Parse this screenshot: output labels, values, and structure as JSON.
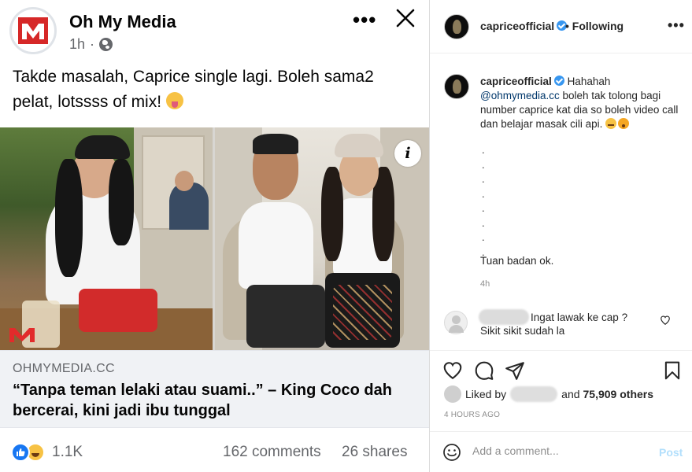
{
  "facebook": {
    "page_name": "Oh My Media",
    "post_time": "1h",
    "separator": "·",
    "post_text": "Takde masalah, Caprice single lagi. Boleh sama2 pelat, lotssss of mix!",
    "link": {
      "domain": "OHMYMEDIA.CC",
      "headline": "“Tanpa teman lelaki atau suami..” – King Coco dah bercerai, kini jadi ibu tunggal"
    },
    "reactions_count": "1.1K",
    "comments": "162 comments",
    "shares": "26 shares",
    "info_glyph": "i",
    "icons": {
      "more": "more-horizontal-icon",
      "close": "close-icon",
      "privacy": "globe-icon",
      "like": "like-reaction-icon",
      "haha": "haha-reaction-icon"
    },
    "colors": {
      "accent": "#1877f2",
      "secondary_text": "#65676b"
    }
  },
  "instagram": {
    "username": "capriceofficial",
    "following_label": "• Following",
    "caption": {
      "username": "capriceofficial",
      "text_before": "Hahahah",
      "mention": "@ohmymedia.cc",
      "text_after": "boleh tak tolong bagi number caprice kat dia so boleh video call dan belajar masak cili api.",
      "dots": [
        ".",
        ".",
        ".",
        ".",
        ".",
        ".",
        ".",
        "."
      ],
      "closing": "Tuan badan ok.",
      "time": "4h"
    },
    "comment": {
      "line1": "Ingat lawak ke cap ?",
      "line2": "Sikit sikit sudah la"
    },
    "liked_by_prefix": "Liked by",
    "liked_by_suffix": "and",
    "likes_count": "75,909 others",
    "timestamp": "4 HOURS AGO",
    "add_comment_placeholder": "Add a comment...",
    "post_label": "Post",
    "icons": {
      "more": "more-horizontal-icon",
      "verified": "verified-badge-icon",
      "like": "heart-icon",
      "comment": "comment-icon",
      "share": "send-icon",
      "save": "bookmark-icon",
      "emoji": "smiley-icon"
    },
    "colors": {
      "mention": "#00376b",
      "post_disabled": "#b2dffc",
      "verified": "#3897f0"
    }
  }
}
